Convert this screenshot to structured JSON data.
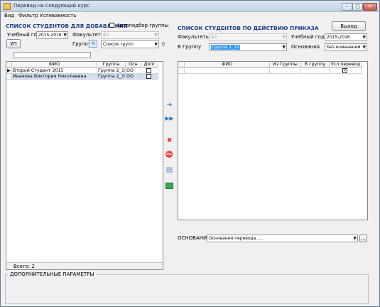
{
  "window": {
    "title": "Перевод на следующий курс",
    "min_label": "−",
    "max_label": "□",
    "close_label": "✕"
  },
  "menu": [
    "Вид",
    "Фильтр",
    "Успеваемость"
  ],
  "left": {
    "header": "СПИСОК СТУДЕНТОВ ДЛЯ ДОБАВЛЕНИЯ",
    "auto_select_label": "Автоподбор группы",
    "year_label": "Учебный год",
    "year_value": "2015-2016",
    "faculty_label": "Факультеты",
    "faculty_value": "Ф1",
    "group_label": "Группу",
    "group_value": "Список групп",
    "up_button": "УП",
    "columns": [
      "ФИО",
      "Группа",
      "Осн",
      "Долг"
    ],
    "rows": [
      {
        "fio": "Второй Студент 2015",
        "group": "Группа 2_15",
        "osn": "ОО",
        "debt": false
      },
      {
        "fio": "Иванова Виктория Николаевна",
        "group": "Группа 2_15",
        "osn": "ОО",
        "debt": false
      }
    ],
    "total": "Всего: 2"
  },
  "right": {
    "header": "СПИСОК СТУДЕНТОВ ПО ДЕЙСТВИЮ ПРИКАЗА",
    "exit_button": "Выход",
    "faculty_label": "Факультеты",
    "faculty_value": "Ф1",
    "year_label": "Учебный год",
    "year_value": "2015-2016",
    "to_group_label": "В Группу",
    "to_group_value": "Группа 1_15",
    "basis_label": "Основания",
    "basis_value": "Без изменений",
    "columns": [
      "ФИО",
      "Из Группы",
      "В группу",
      "Усл перевод"
    ],
    "cond_checked": true,
    "osnovaniya_label": "ОСНОВАНИЯ",
    "osnovaniya_value": "Основания перевода.....",
    "ellipsis_button": "..."
  },
  "toolbar_icons": [
    "arrow-right-icon",
    "double-arrow-right-icon",
    "delete-icon",
    "remove-user-icon",
    "copy-icon",
    "save-icon"
  ],
  "bottom": {
    "label": "ДОПОЛНИТЕЛЬНЫЕ ПАРАМЕТРЫ"
  }
}
